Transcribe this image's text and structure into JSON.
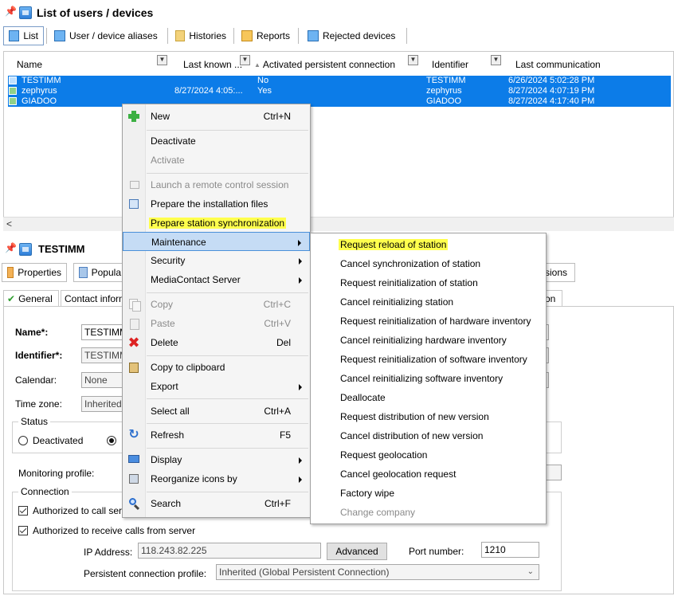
{
  "window": {
    "title": "List of users / devices"
  },
  "tabs": [
    {
      "label": "List"
    },
    {
      "label": "User / device aliases"
    },
    {
      "label": "Histories"
    },
    {
      "label": "Reports"
    },
    {
      "label": "Rejected devices"
    }
  ],
  "list": {
    "columns": [
      "Name",
      "Last known ...",
      "Activated persistent connection",
      "Identifier",
      "Last communication"
    ],
    "rows": [
      {
        "name": "TESTIMM",
        "last_known": "",
        "persistent": "No",
        "identifier": "TESTIMM",
        "last_comm": "6/26/2024 5:02:28 PM"
      },
      {
        "name": "zephyrus",
        "last_known": "8/27/2024 4:05:...",
        "persistent": "Yes",
        "identifier": "zephyrus",
        "last_comm": "8/27/2024 4:07:19 PM"
      },
      {
        "name": "GIADOO",
        "last_known": "",
        "persistent": "",
        "identifier": "GIADOO",
        "last_comm": "8/27/2024 4:17:40 PM"
      }
    ],
    "scroll_left": "<"
  },
  "detail": {
    "title": "TESTIMM",
    "tabs": {
      "properties": "Properties",
      "popula": "Popula",
      "sions": "sions"
    },
    "subtabs": {
      "general": "General",
      "contact": "Contact inform",
      "on": "on"
    },
    "form": {
      "name_label": "Name*:",
      "name_value": "TESTIMM",
      "identifier_label": "Identifier*:",
      "identifier_value": "TESTIMM",
      "calendar_label": "Calendar:",
      "calendar_value": "None",
      "timezone_label": "Time zone:",
      "timezone_value": "Inherited (",
      "status_label": "Status",
      "deactivated_label": "Deactivated",
      "monitoring_label": "Monitoring profile:",
      "connection_label": "Connection",
      "auth_call_label": "Authorized to call serve",
      "auth_receive_label": "Authorized to receive calls from server",
      "ip_label": "IP Address:",
      "ip_value": "118.243.82.225",
      "advanced_label": "Advanced",
      "port_label": "Port number:",
      "port_value": "1210",
      "persistent_profile_label": "Persistent connection profile:",
      "persistent_profile_value": "Inherited (Global Persistent Connection)"
    }
  },
  "context_menu": {
    "items": [
      {
        "label": "New",
        "shortcut": "Ctrl+N"
      },
      {
        "label": "Deactivate"
      },
      {
        "label": "Activate"
      },
      {
        "label": "Launch a remote control session"
      },
      {
        "label": "Prepare the installation files"
      },
      {
        "label": "Prepare station synchronization"
      },
      {
        "label": "Maintenance"
      },
      {
        "label": "Security"
      },
      {
        "label": "MediaContact Server"
      },
      {
        "label": "Copy",
        "shortcut": "Ctrl+C"
      },
      {
        "label": "Paste",
        "shortcut": "Ctrl+V"
      },
      {
        "label": "Delete",
        "shortcut": "Del"
      },
      {
        "label": "Copy to clipboard"
      },
      {
        "label": "Export"
      },
      {
        "label": "Select all",
        "shortcut": "Ctrl+A"
      },
      {
        "label": "Refresh",
        "shortcut": "F5"
      },
      {
        "label": "Display"
      },
      {
        "label": "Reorganize icons by"
      },
      {
        "label": "Search",
        "shortcut": "Ctrl+F"
      }
    ]
  },
  "submenu": {
    "items": [
      "Request reload of station",
      "Cancel synchronization of station",
      "Request reinitialization of station",
      "Cancel reinitializing station",
      "Request reinitialization of hardware inventory",
      "Cancel reinitializing hardware inventory",
      "Request reinitialization of software inventory",
      "Cancel reinitializing software inventory",
      "Deallocate",
      "Request distribution of new version",
      "Cancel distribution of new version",
      "Request geolocation",
      "Cancel geolocation request",
      "Factory wipe",
      "Change company"
    ]
  },
  "colors": {
    "selection": "#0c7ce8",
    "highlight": "#ffff4d",
    "menu_hover": "#c5dcf5"
  }
}
